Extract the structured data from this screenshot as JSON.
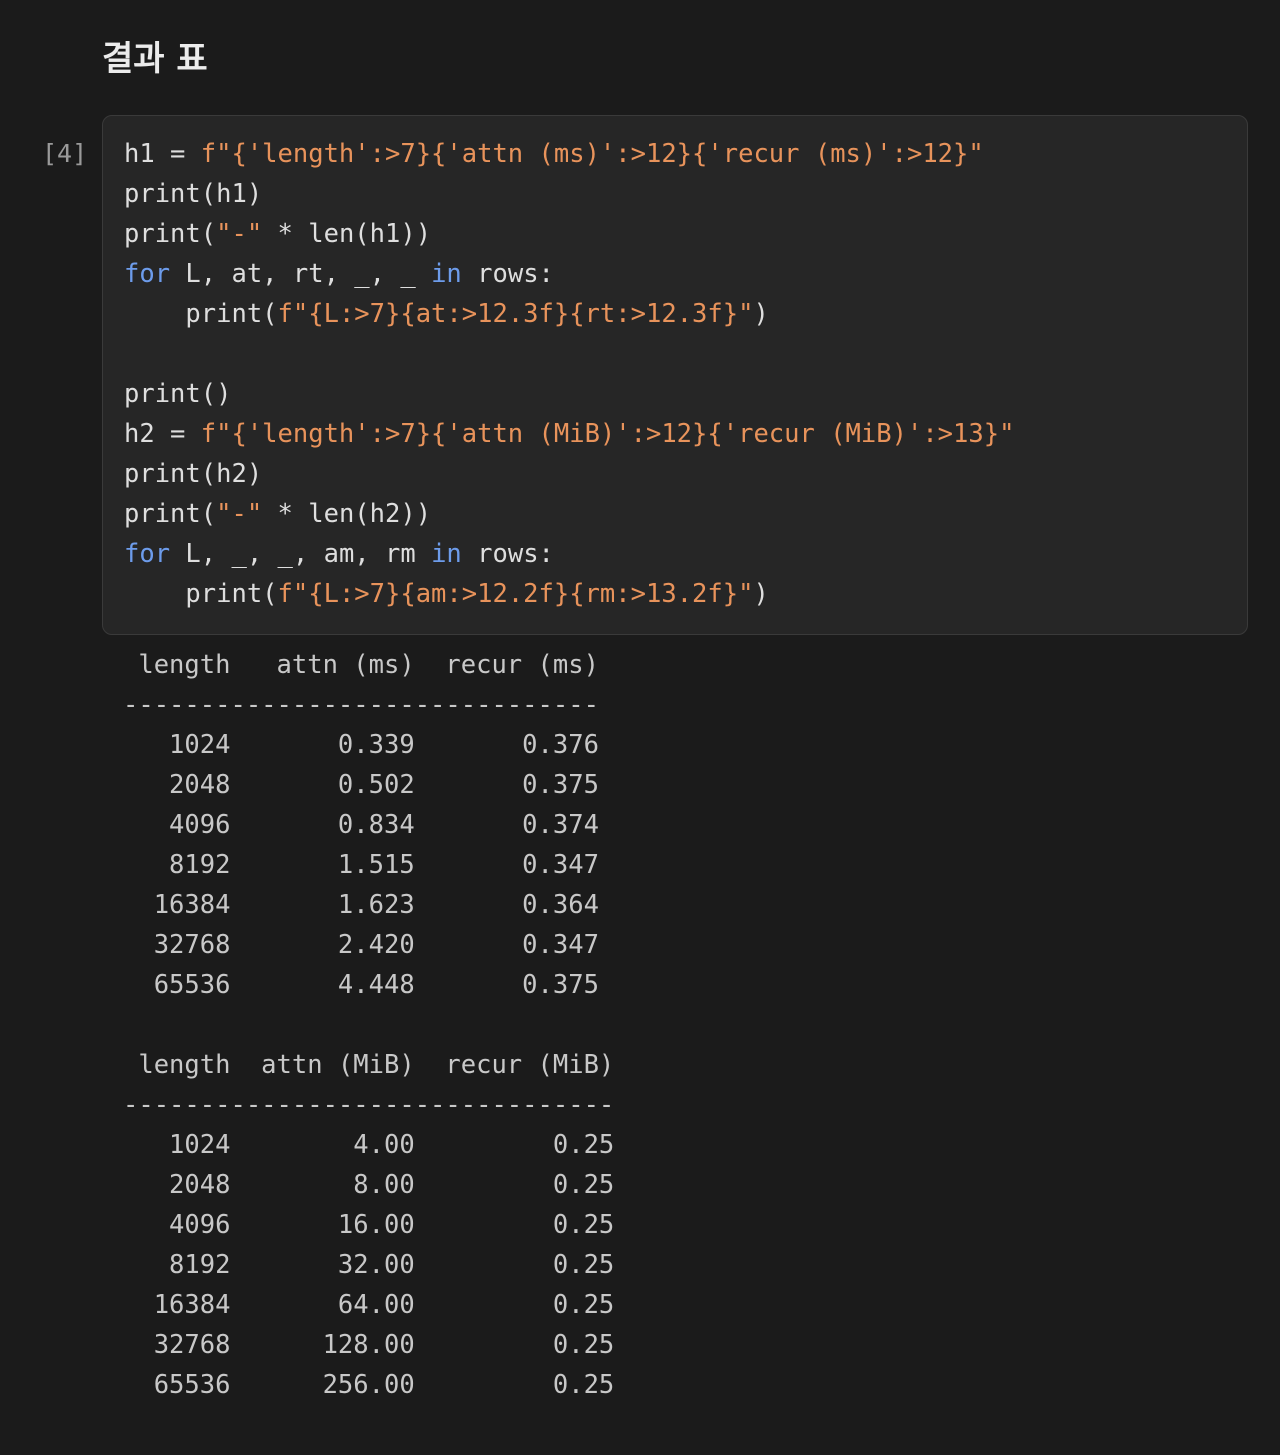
{
  "section": {
    "title": "결과 표"
  },
  "cell": {
    "execution_count": "[4]",
    "code_lines": [
      [
        {
          "t": "h1 = ",
          "c": ""
        },
        {
          "t": "f\"{'length':>7}{'attn (ms)':>12}{'recur (ms)':>12}\"",
          "c": "str"
        }
      ],
      [
        {
          "t": "print(h1)",
          "c": ""
        }
      ],
      [
        {
          "t": "print(",
          "c": ""
        },
        {
          "t": "\"-\"",
          "c": "str"
        },
        {
          "t": " * len(h1))",
          "c": ""
        }
      ],
      [
        {
          "t": "for",
          "c": "kw"
        },
        {
          "t": " L, at, rt, _, _ ",
          "c": ""
        },
        {
          "t": "in",
          "c": "kw"
        },
        {
          "t": " rows:",
          "c": ""
        }
      ],
      [
        {
          "t": "    print(",
          "c": ""
        },
        {
          "t": "f\"{L:>7}{at:>12.3f}{rt:>12.3f}\"",
          "c": "str"
        },
        {
          "t": ")",
          "c": ""
        }
      ],
      [
        {
          "t": "",
          "c": ""
        }
      ],
      [
        {
          "t": "print()",
          "c": ""
        }
      ],
      [
        {
          "t": "h2 = ",
          "c": ""
        },
        {
          "t": "f\"{'length':>7}{'attn (MiB)':>12}{'recur (MiB)':>13}\"",
          "c": "str"
        }
      ],
      [
        {
          "t": "print(h2)",
          "c": ""
        }
      ],
      [
        {
          "t": "print(",
          "c": ""
        },
        {
          "t": "\"-\"",
          "c": "str"
        },
        {
          "t": " * len(h2))",
          "c": ""
        }
      ],
      [
        {
          "t": "for",
          "c": "kw"
        },
        {
          "t": " L, _, _, am, rm ",
          "c": ""
        },
        {
          "t": "in",
          "c": "kw"
        },
        {
          "t": " rows:",
          "c": ""
        }
      ],
      [
        {
          "t": "    print(",
          "c": ""
        },
        {
          "t": "f\"{L:>7}{am:>12.2f}{rm:>13.2f}\"",
          "c": "str"
        },
        {
          "t": ")",
          "c": ""
        }
      ]
    ]
  },
  "output_lines": [
    " length   attn (ms)  recur (ms)",
    "-------------------------------",
    "   1024       0.339       0.376",
    "   2048       0.502       0.375",
    "   4096       0.834       0.374",
    "   8192       1.515       0.347",
    "  16384       1.623       0.364",
    "  32768       2.420       0.347",
    "  65536       4.448       0.375",
    "",
    " length  attn (MiB)  recur (MiB)",
    "--------------------------------",
    "   1024        4.00         0.25",
    "   2048        8.00         0.25",
    "   4096       16.00         0.25",
    "   8192       32.00         0.25",
    "  16384       64.00         0.25",
    "  32768      128.00         0.25",
    "  65536      256.00         0.25"
  ]
}
